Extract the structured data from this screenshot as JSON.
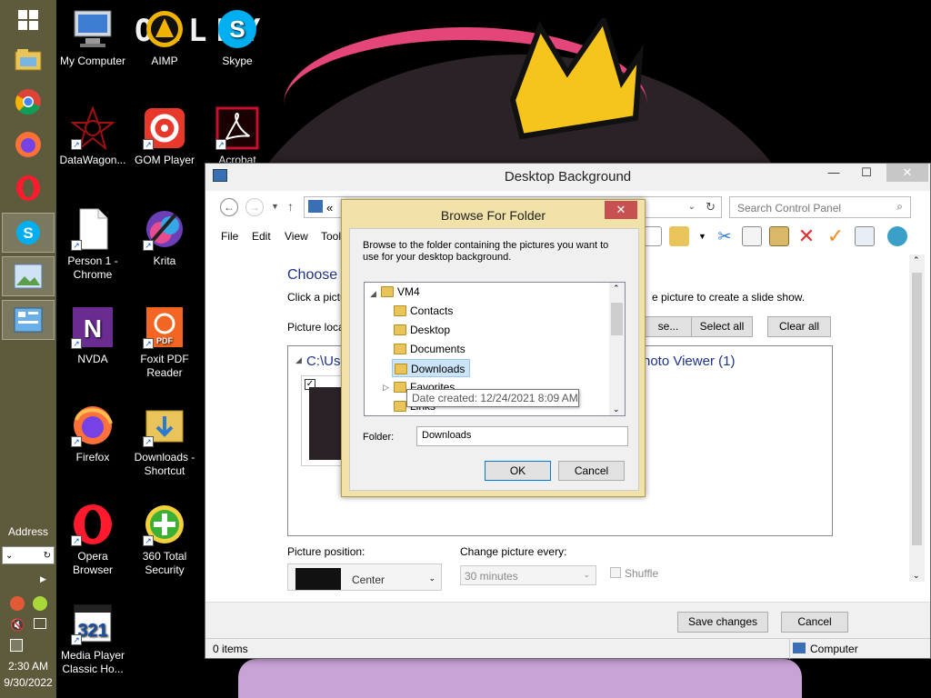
{
  "wallpaper": {
    "logo_text": "OXLLY"
  },
  "taskbar": {
    "address_label": "Address",
    "clock_time": "2:30 AM",
    "clock_date": "9/30/2022"
  },
  "desktop_icons": [
    {
      "label": "My Computer",
      "icon": "computer-icon",
      "color": "#4a7fc0"
    },
    {
      "label": "AIMP",
      "icon": "aimp-icon",
      "color": "#f0b400"
    },
    {
      "label": "Skype",
      "icon": "skype-icon",
      "color": "#00aff0"
    },
    {
      "label": "DataWagon...",
      "icon": "datawagon-icon",
      "color": "#a01010"
    },
    {
      "label": "GOM Player",
      "icon": "gom-player-icon",
      "color": "#e8382c"
    },
    {
      "label": "Acrobat",
      "icon": "acrobat-icon",
      "color": "#c8102e"
    },
    {
      "label": "Person 1 - Chrome",
      "icon": "file-icon",
      "color": "#ffffff"
    },
    {
      "label": "Krita",
      "icon": "krita-icon",
      "color": "#6d3fb6"
    },
    {
      "label": "NVDA",
      "icon": "nvda-icon",
      "color": "#6a2c91"
    },
    {
      "label": "Foxit PDF Reader",
      "icon": "foxit-icon",
      "color": "#f26522"
    },
    {
      "label": "Firefox",
      "icon": "firefox-icon",
      "color": "#ff7139"
    },
    {
      "label": "Downloads - Shortcut",
      "icon": "folder-icon",
      "color": "#e9c45a"
    },
    {
      "label": "Opera Browser",
      "icon": "opera-icon",
      "color": "#ff1b2d"
    },
    {
      "label": "360 Total Security",
      "icon": "360-security-icon",
      "color": "#3cb034"
    },
    {
      "label": "Media Player Classic Ho...",
      "icon": "media-player-icon",
      "color": "#ffffff"
    }
  ],
  "window": {
    "title": "Desktop Background",
    "minimize": "—",
    "maximize": "☐",
    "close": "✕",
    "address_text": "«",
    "search_placeholder": "Search Control Panel",
    "menu": [
      "File",
      "Edit",
      "View",
      "Tool"
    ],
    "heading": "Choose y",
    "instruction_left": "Click a pictu",
    "instruction_right": "e picture to create a slide show.",
    "picture_location_label": "Picture loca",
    "browse_button": "se...",
    "select_all_button": "Select all",
    "clear_all_button": "Clear all",
    "group_left": "C:\\Use",
    "group_right": "hoto Viewer (1)",
    "picture_position_label": "Picture position:",
    "picture_position_value": "Center",
    "change_every_label": "Change picture every:",
    "change_every_value": "30 minutes",
    "shuffle_label": "Shuffle",
    "save_button": "Save changes",
    "cancel_button": "Cancel",
    "status_items": "0 items",
    "status_zone": "Computer"
  },
  "dialog": {
    "title": "Browse For Folder",
    "close": "✕",
    "description": "Browse to the folder containing the pictures you want to use for your desktop background.",
    "tree": [
      {
        "label": "VM4",
        "expanded": true
      },
      {
        "label": "Contacts"
      },
      {
        "label": "Desktop"
      },
      {
        "label": "Documents"
      },
      {
        "label": "Downloads",
        "selected": true
      },
      {
        "label": "Favorites"
      },
      {
        "label": "Links"
      }
    ],
    "tooltip": "Date created: 12/24/2021 8:09 AM",
    "folder_label": "Folder:",
    "folder_value": "Downloads",
    "ok_button": "OK",
    "cancel_button": "Cancel"
  }
}
